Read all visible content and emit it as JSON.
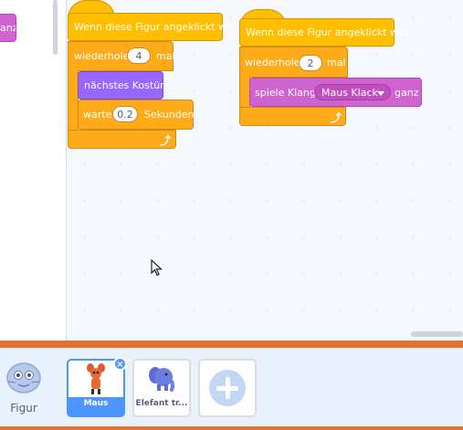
{
  "palette": {
    "block_tail_text": "anz"
  },
  "script1": {
    "hat_label": "Wenn diese Figur angeklickt wird",
    "repeat_label": "wiederhole",
    "repeat_count": "4",
    "repeat_suffix": "mal",
    "costume_label": "nächstes Kostüm",
    "wait_label": "warte",
    "wait_value": "0.2",
    "wait_unit": "Sekunden"
  },
  "script2": {
    "hat_label": "Wenn diese Figur angeklickt wird",
    "repeat_label": "wiederhole",
    "repeat_count": "2",
    "repeat_suffix": "mal",
    "sound_label": "spiele Klang",
    "sound_value": "Maus Klack",
    "sound_suffix": "ganz"
  },
  "sprites_pane": {
    "figure_label": "Figur",
    "sprites": [
      {
        "name": "Maus",
        "selected": true
      },
      {
        "name": "Elefant tr...",
        "selected": false
      }
    ]
  },
  "colors": {
    "events": "#ffbf00",
    "control": "#ffab19",
    "looks": "#9966ff",
    "sound": "#cf63cf",
    "selection": "#4c97ff",
    "accent_orange": "#e6702e"
  }
}
